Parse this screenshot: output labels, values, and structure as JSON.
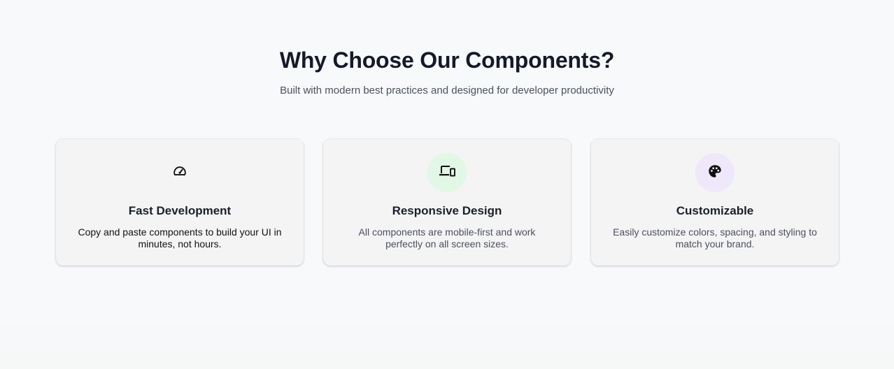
{
  "section": {
    "title": "Why Choose Our Components?",
    "subtitle": "Built with modern best practices and designed for developer productivity"
  },
  "features": [
    {
      "icon": "speedometer-icon",
      "icon_bg": "#f3f4f3",
      "title": "Fast Development",
      "description": "Copy and paste components to build your UI in minutes, not hours."
    },
    {
      "icon": "devices-icon",
      "icon_bg": "#e3f7e6",
      "title": "Responsive Design",
      "description": "All components are mobile-first and work perfectly on all screen sizes."
    },
    {
      "icon": "palette-icon",
      "icon_bg": "#efe8fb",
      "title": "Customizable",
      "description": "Easily customize colors, spacing, and styling to match your brand."
    }
  ]
}
